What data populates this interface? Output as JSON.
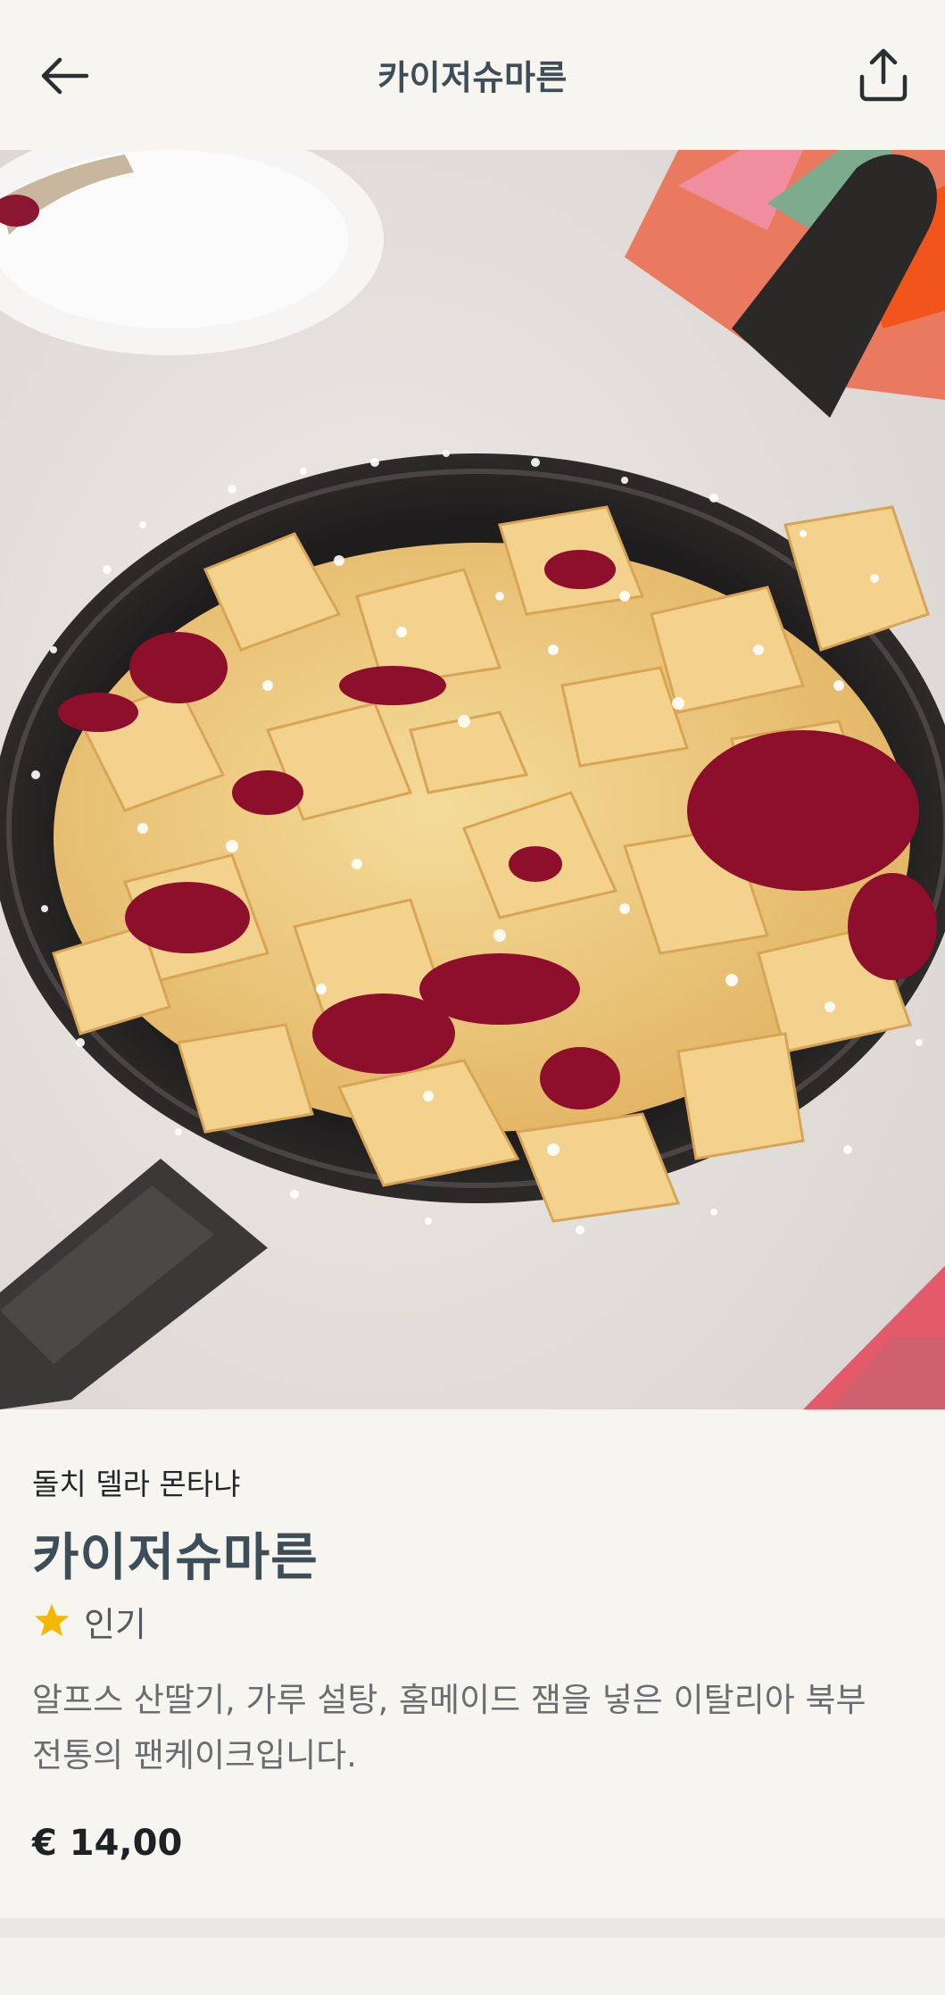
{
  "header": {
    "title": "카이저슈마른",
    "back_icon": "arrow-left-icon",
    "share_icon": "share-icon"
  },
  "hero_image": {
    "subject": "kaiserschmarrn-in-cast-iron-pan"
  },
  "dish": {
    "restaurant": "돌치 델라 몬타냐",
    "name": "카이저슈마른",
    "badge_icon": "star-icon",
    "badge_label": "인기",
    "description": "알프스 산딸기, 가루 설탕, 홈메이드 잼을 넣은 이탈리아 북부 전통의 팬케이크입니다.",
    "price": "€ 14,00"
  },
  "colors": {
    "background": "#f7f5ef",
    "title": "#3e4e59",
    "star": "#f5b800"
  }
}
